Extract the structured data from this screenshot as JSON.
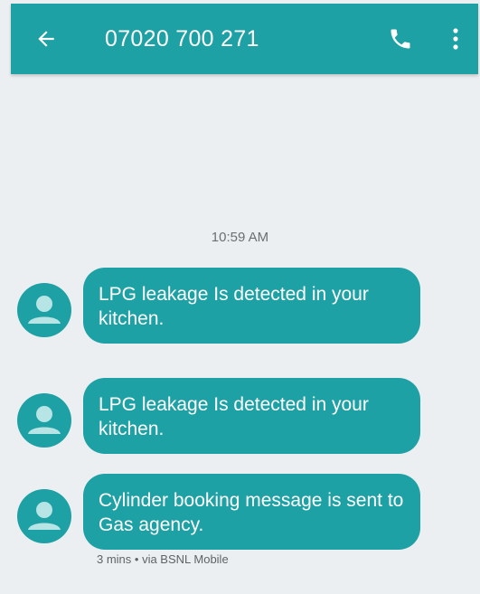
{
  "header": {
    "title": "07020 700 271",
    "back_icon": "arrow-back-icon",
    "call_icon": "phone-icon",
    "menu_icon": "more-vert-icon",
    "color": "#1ea1a5"
  },
  "conversation": {
    "timestamp": "10:59 AM",
    "messages": [
      {
        "text": "LPG leakage Is detected in your kitchen.",
        "avatar_icon": "person-icon"
      },
      {
        "text": "LPG leakage Is detected in your kitchen.",
        "avatar_icon": "person-icon"
      },
      {
        "text": "Cylinder booking message is sent to  Gas agency.",
        "avatar_icon": "person-icon"
      }
    ],
    "last_meta": "3 mins • via BSNL Mobile"
  },
  "colors": {
    "accent": "#1ea1a5",
    "background": "#eceff1",
    "bubble_text": "#ffffff"
  }
}
